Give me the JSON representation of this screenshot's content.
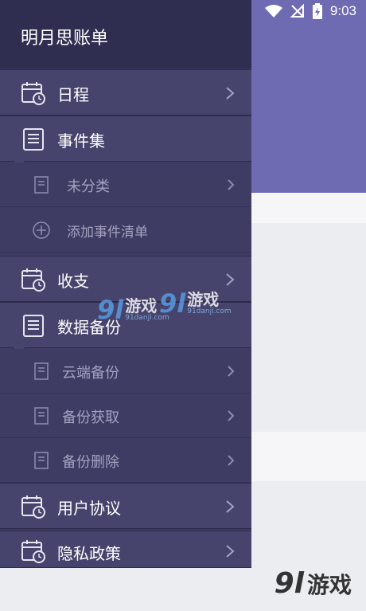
{
  "status_bar": {
    "time": "9:03"
  },
  "drawer": {
    "title": "明月思账单",
    "items": [
      {
        "label": "日程"
      },
      {
        "label": "事件集"
      },
      {
        "label": "收支"
      },
      {
        "label": "数据备份"
      },
      {
        "label": "用户协议"
      },
      {
        "label": "隐私政策"
      }
    ],
    "event_sub": [
      {
        "label": "未分类"
      },
      {
        "label": "添加事件清单"
      }
    ],
    "backup_sub": [
      {
        "label": "云端备份"
      },
      {
        "label": "备份获取"
      },
      {
        "label": "备份删除"
      }
    ]
  },
  "watermark": {
    "logo_num": "9l",
    "logo_text": "游戏",
    "site": "91danji.com"
  },
  "colors": {
    "header": "#6E6BB3",
    "drawer": "#3E3C63",
    "drawer_item": "#46446D",
    "title_bar": "#2F2D50"
  }
}
